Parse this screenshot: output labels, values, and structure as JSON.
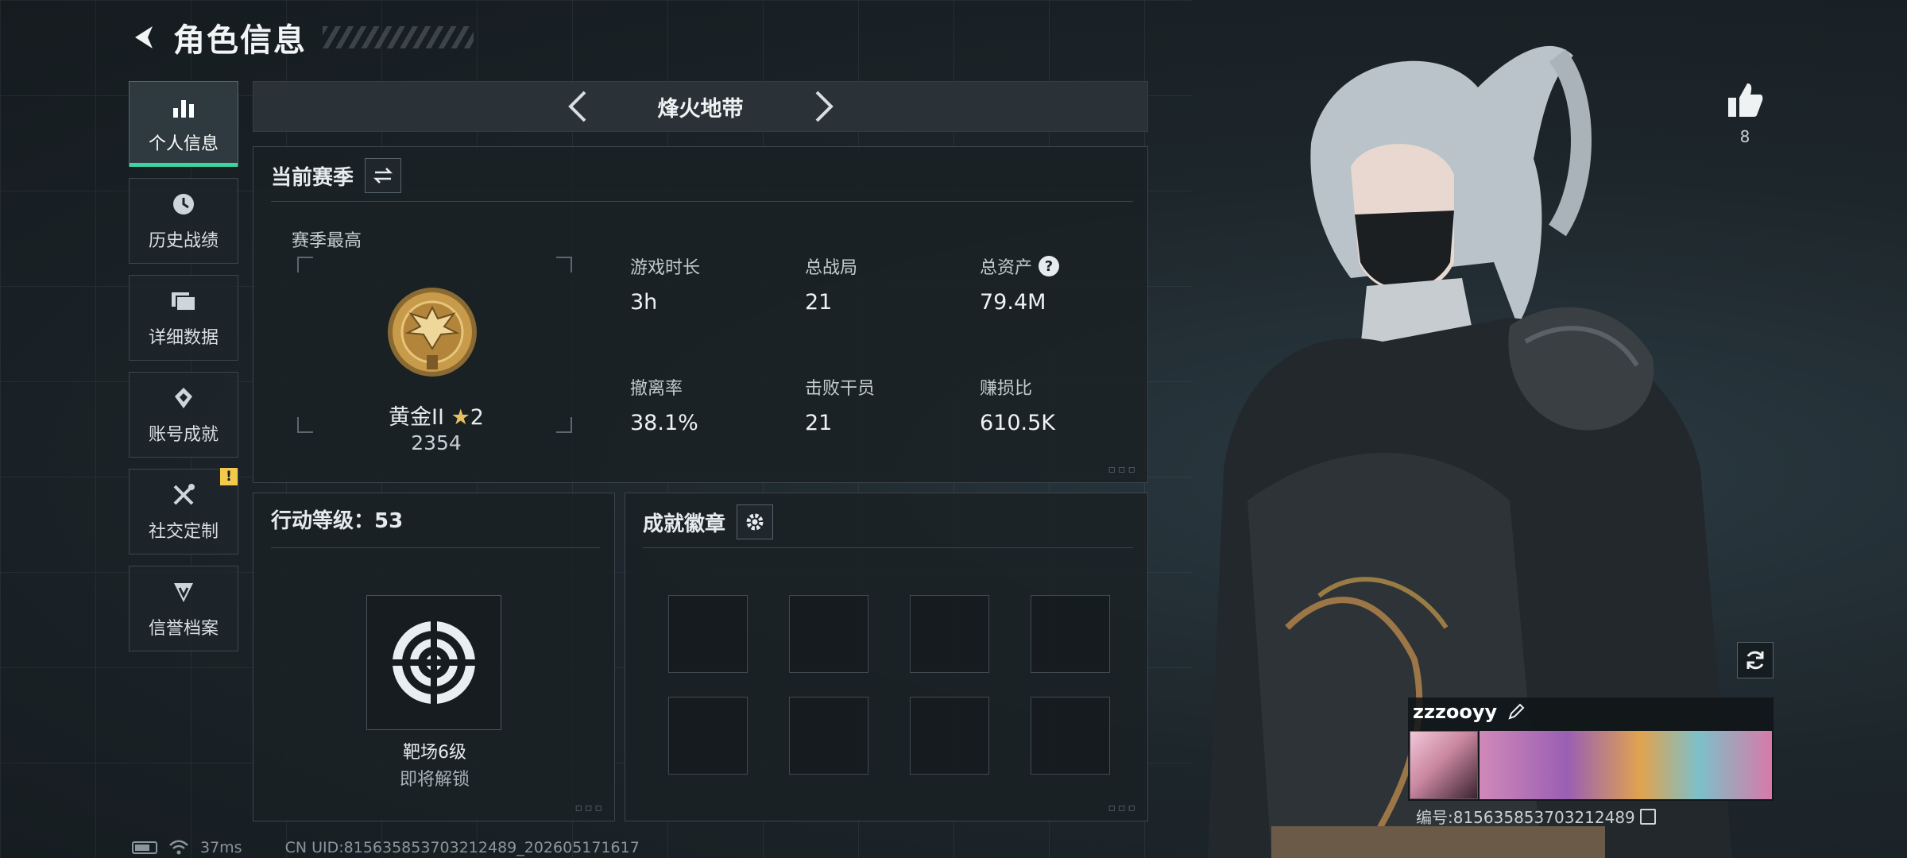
{
  "header": {
    "title": "角色信息"
  },
  "sidebar": {
    "items": [
      {
        "label": "个人信息",
        "icon": "bar-chart-icon",
        "active": true
      },
      {
        "label": "历史战绩",
        "icon": "clock-icon"
      },
      {
        "label": "详细数据",
        "icon": "folder-icon"
      },
      {
        "label": "账号成就",
        "icon": "achievement-icon"
      },
      {
        "label": "社交定制",
        "icon": "tools-icon",
        "badge": "!"
      },
      {
        "label": "信誉档案",
        "icon": "credit-icon"
      }
    ]
  },
  "mode": {
    "name": "烽火地带"
  },
  "season": {
    "title": "当前赛季",
    "best_label": "赛季最高",
    "rank_name": "黄金II",
    "rank_stars": "2",
    "rank_score": "2354",
    "stats": [
      {
        "label": "游戏时长",
        "value": "3h"
      },
      {
        "label": "总战局",
        "value": "21"
      },
      {
        "label": "总资产",
        "value": "79.4M",
        "help": "?"
      },
      {
        "label": "撤离率",
        "value": "38.1%"
      },
      {
        "label": "击败干员",
        "value": "21"
      },
      {
        "label": "赚损比",
        "value": "610.5K"
      }
    ]
  },
  "action_level": {
    "title": "行动等级：53",
    "item_name": "靶场6级",
    "item_status": "即将解锁"
  },
  "badges": {
    "title": "成就徽章",
    "slots": 8
  },
  "player": {
    "likes": "8",
    "name": "zzzooyy",
    "id_text": "编号:815635853703212489"
  },
  "status": {
    "ping": "37ms",
    "uid": "CN UID:815635853703212489_202605171617"
  },
  "colors": {
    "accent": "#3ed3a0",
    "warn": "#f2c94c",
    "gold": "#c89b4a"
  }
}
